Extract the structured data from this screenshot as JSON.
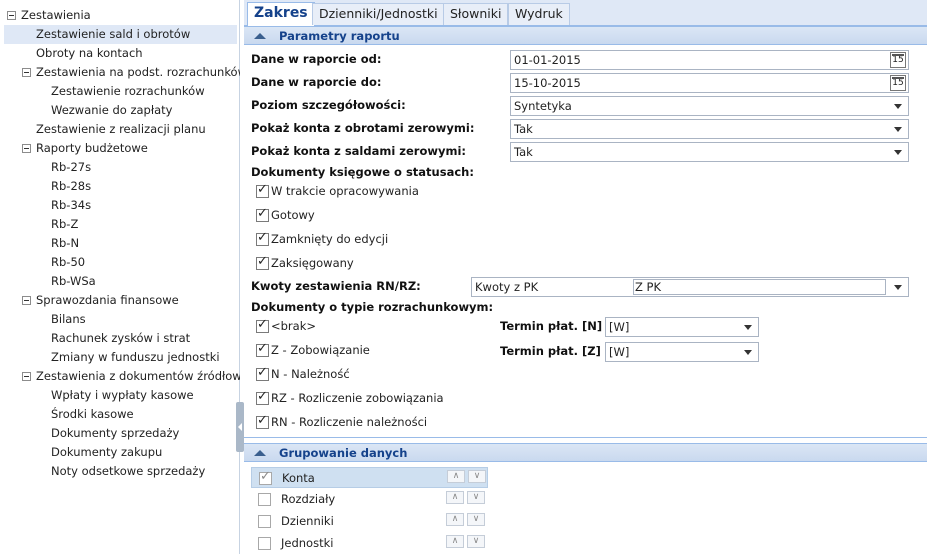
{
  "tree": {
    "items": [
      {
        "label": "Zestawienia"
      },
      {
        "label": "Zestawienie sald i obrotów"
      },
      {
        "label": "Obroty na kontach"
      },
      {
        "label": "Zestawienia na podst. rozrachunków"
      },
      {
        "label": "Zestawienie rozrachunków"
      },
      {
        "label": "Wezwanie do zapłaty"
      },
      {
        "label": "Zestawienie z realizacji planu"
      },
      {
        "label": "Raporty budżetowe"
      },
      {
        "label": "Rb-27s"
      },
      {
        "label": "Rb-28s"
      },
      {
        "label": "Rb-34s"
      },
      {
        "label": "Rb-Z"
      },
      {
        "label": "Rb-N"
      },
      {
        "label": "Rb-50"
      },
      {
        "label": "Rb-WSa"
      },
      {
        "label": "Sprawozdania finansowe"
      },
      {
        "label": "Bilans"
      },
      {
        "label": "Rachunek zysków i strat"
      },
      {
        "label": "Zmiany w funduszu jednostki"
      },
      {
        "label": "Zestawienia z dokumentów źródłowych"
      },
      {
        "label": "Wpłaty i wypłaty kasowe"
      },
      {
        "label": "Środki kasowe"
      },
      {
        "label": "Dokumenty sprzedaży"
      },
      {
        "label": "Dokumenty zakupu"
      },
      {
        "label": "Noty odsetkowe sprzedaży"
      }
    ]
  },
  "tabs": [
    "Zakres",
    "Dzienniki/Jednostki",
    "Słowniki",
    "Wydruk"
  ],
  "params": {
    "header": "Parametry raportu",
    "date_from_label": "Dane w raporcie od:",
    "date_from": "01-01-2015",
    "date_to_label": "Dane w raporcie do:",
    "date_to": "15-10-2015",
    "calendar_day": "15",
    "detail_label": "Poziom szczegółowości:",
    "detail_value": "Syntetyka",
    "zero_turnover_label": "Pokaż konta z obrotami zerowymi:",
    "zero_turnover_value": "Tak",
    "zero_balance_label": "Pokaż konta z saldami zerowymi:",
    "zero_balance_value": "Tak",
    "doc_status_label": "Dokumenty księgowe o statusach:",
    "statuses": [
      {
        "label": "W trakcie opracowywania",
        "checked": true
      },
      {
        "label": "Gotowy",
        "checked": true
      },
      {
        "label": "Zamknięty do edycji",
        "checked": true
      },
      {
        "label": "Zaksięgowany",
        "checked": true
      }
    ],
    "rn_rz_label": "Kwoty zestawienia RN/RZ:",
    "rn_rz_value_a": "Kwoty z PK",
    "rn_rz_value_b": "Z PK",
    "settlement_label": "Dokumenty o typie rozrachunkowym:",
    "settlement_types": [
      {
        "label": "<brak>",
        "checked": true
      },
      {
        "label": "Z - Zobowiązanie",
        "checked": true
      },
      {
        "label": "N - Należność",
        "checked": true
      },
      {
        "label": "RZ - Rozliczenie zobowiązania",
        "checked": true
      },
      {
        "label": "RN - Rozliczenie należności",
        "checked": true
      }
    ],
    "term_n_label": "Termin płat. [N]",
    "term_n_value": "[W]",
    "term_z_label": "Termin płat. [Z]",
    "term_z_value": "[W]"
  },
  "grouping": {
    "header": "Grupowanie danych",
    "rows": [
      {
        "label": "Konta",
        "checked": true
      },
      {
        "label": "Rozdziały",
        "checked": false
      },
      {
        "label": "Dzienniki",
        "checked": false
      },
      {
        "label": "Jednostki",
        "checked": false
      }
    ],
    "up_glyph": "∧",
    "down_glyph": "∨"
  }
}
